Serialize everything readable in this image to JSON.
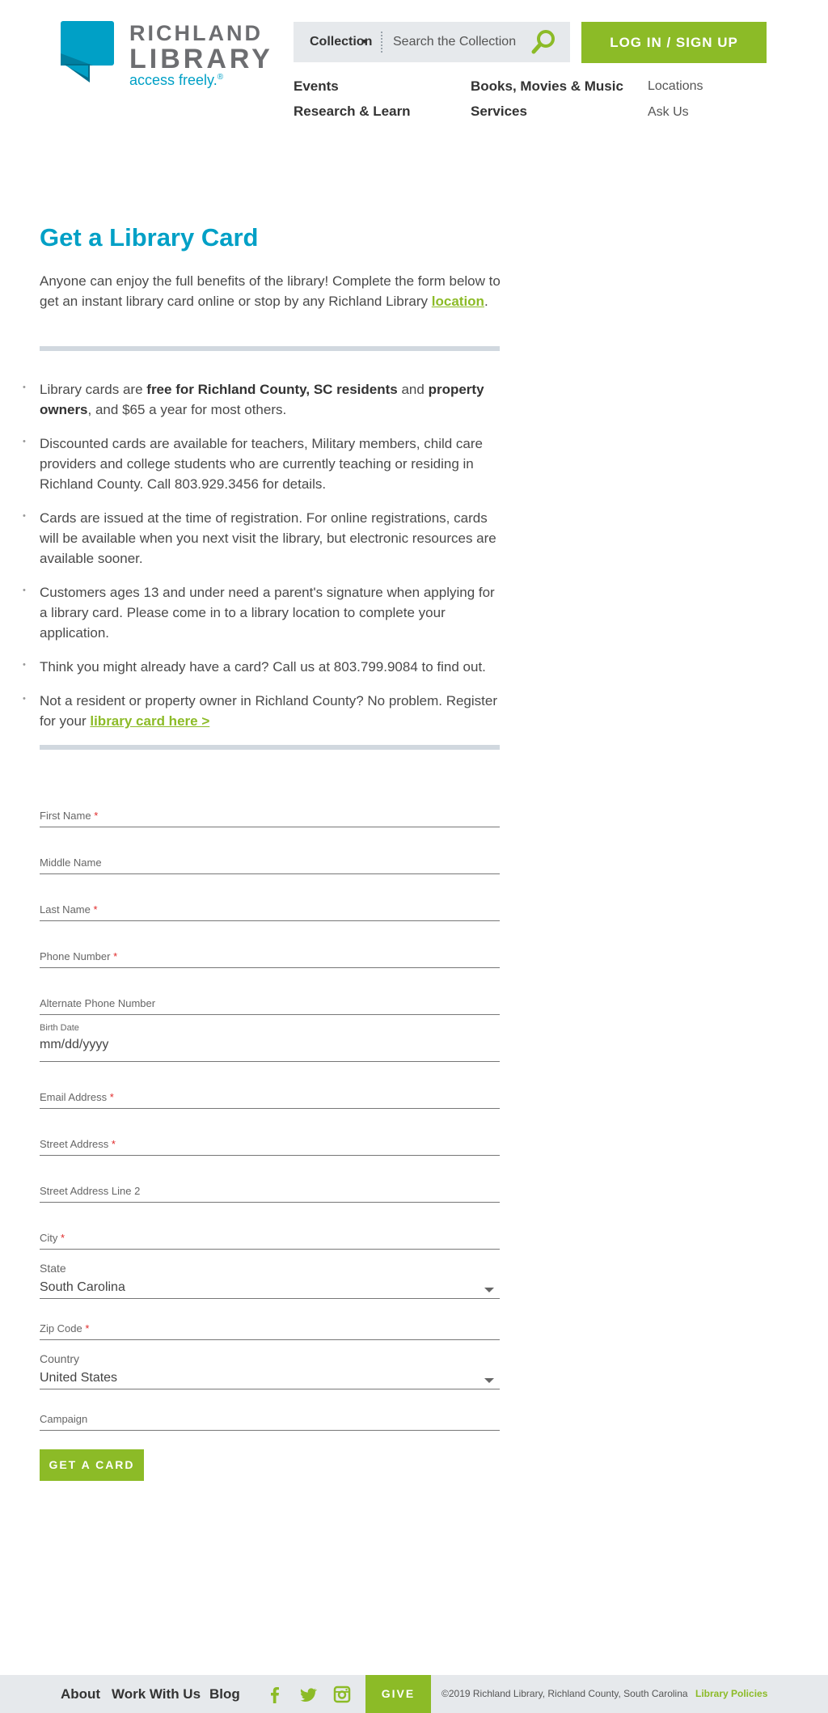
{
  "header": {
    "logo_line1": "RICHLAND",
    "logo_line2": "LIBRARY",
    "logo_tagline": "access freely.",
    "logo_reg": "®",
    "search_category": "Collection",
    "search_placeholder": "Search the Collection",
    "login_label": "LOG IN / SIGN UP",
    "nav_main": [
      "Events",
      "Research & Learn",
      "Books, Movies & Music",
      "Services"
    ],
    "nav_util": [
      "Locations",
      "Ask Us"
    ]
  },
  "colors": {
    "brand_blue": "#00a0c6",
    "brand_green": "#8cbb27",
    "rule_gray": "#d1d8df"
  },
  "main": {
    "title": "Get a Library Card",
    "intro_text": "Anyone can enjoy the full benefits of the library! Complete the form below to get an instant library card online or stop by any Richland Library ",
    "intro_link": "location",
    "intro_end": ".",
    "bullets": {
      "b1_a": "Library cards are ",
      "b1_bold1": "free for Richland County, SC residents",
      "b1_b": " and ",
      "b1_bold2": "property owners",
      "b1_c": ", and $65 a year for most others.",
      "b2": "Discounted cards are available for teachers, Military members, child care providers and college students who are currently teaching or residing in Richland County. Call 803.929.3456 for details.",
      "b3": "Cards are issued at the time of registration. For online registrations, cards will be available when you next visit the library, but electronic resources are available sooner.",
      "b4": "Customers ages 13 and under need a parent's signature when applying for a library card. Please come in to a library location to complete your application.",
      "b5": "Think you might already have a card? Call us at 803.799.9084 to find out.",
      "b6_a": "Not a resident or property owner in Richland County? No problem. Register for your ",
      "b6_link": "library card here >"
    }
  },
  "form": {
    "first_name": "First Name",
    "middle_name": "Middle Name",
    "last_name": "Last Name",
    "phone": "Phone Number",
    "alt_phone": "Alternate Phone Number",
    "birth_label": "Birth Date",
    "birth_placeholder": "mm/dd/yyyy",
    "email": "Email Address",
    "street": "Street Address",
    "street2": "Street Address Line 2",
    "city": "City",
    "state_label": "State",
    "state_value": "South Carolina",
    "zip": "Zip Code",
    "country_label": "Country",
    "country_value": "United States",
    "campaign": "Campaign",
    "required_mark": "*",
    "submit_label": "GET A CARD"
  },
  "footer": {
    "links": [
      "About",
      "Work With Us",
      "Blog"
    ],
    "social_icons": [
      "facebook-icon",
      "twitter-icon",
      "instagram-icon"
    ],
    "give_label": "GIVE",
    "copyright": "©2019 Richland Library, Richland County, South Carolina",
    "policies": "Library Policies"
  }
}
